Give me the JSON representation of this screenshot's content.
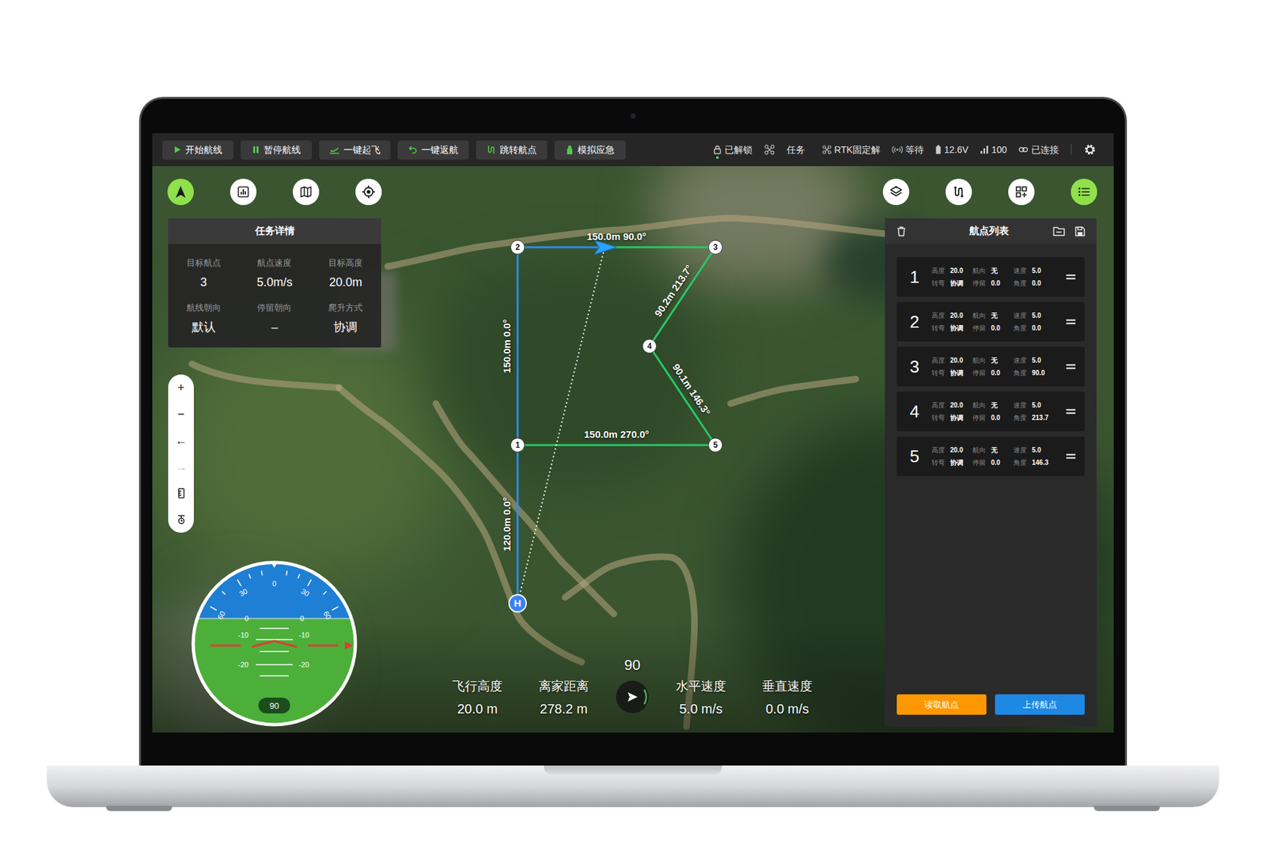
{
  "toolbar": {
    "actions": [
      "开始航线",
      "暂停航线",
      "一键起飞",
      "一键返航",
      "跳转航点",
      "模拟应急"
    ],
    "status": {
      "lock": {
        "label": "已解锁",
        "indicator": true
      },
      "mode": "任务",
      "rtk": "RTK固定解",
      "link_state": "等待",
      "voltage": "12.6V",
      "signal": "100",
      "connection": "已连接"
    }
  },
  "map_buttons": {
    "left": [
      {
        "selected": true
      },
      {
        "selected": false
      },
      {
        "selected": false
      },
      {
        "selected": false
      }
    ],
    "right": [
      {
        "selected": false
      },
      {
        "selected": false
      },
      {
        "selected": false
      },
      {
        "selected": true
      }
    ]
  },
  "mission": {
    "title": "任务详情",
    "fields": [
      {
        "label": "目标航点",
        "value": "3"
      },
      {
        "label": "航点速度",
        "value": "5.0m/s"
      },
      {
        "label": "目标高度",
        "value": "20.0m"
      },
      {
        "label": "航线朝向",
        "value": "默认"
      },
      {
        "label": "停留朝向",
        "value": "–"
      },
      {
        "label": "爬升方式",
        "value": "协调"
      }
    ]
  },
  "zoom_tools": [
    {
      "label": "+",
      "disabled": false
    },
    {
      "label": "−",
      "disabled": false
    },
    {
      "label": "←",
      "disabled": false
    },
    {
      "label": "→",
      "disabled": true
    }
  ],
  "route": {
    "points": [
      {
        "label": "H",
        "kind": "home"
      },
      {
        "label": "1",
        "kind": "waypoint"
      },
      {
        "label": "2",
        "kind": "waypoint"
      },
      {
        "label": "3",
        "kind": "waypoint"
      },
      {
        "label": "4",
        "kind": "waypoint"
      },
      {
        "label": "5",
        "kind": "waypoint"
      }
    ],
    "segments": [
      {
        "label": "120.0m 0.0°",
        "level": 1
      },
      {
        "label": "150.0m 0.0°",
        "level": 1
      },
      {
        "label": "150.0m 90.0°",
        "level": 0.44
      },
      {
        "label": "90.2m 213.7°",
        "level": 0
      },
      {
        "label": "90.1m 146.3°",
        "level": 0
      },
      {
        "label": "150.0m 270.0°",
        "level": 0
      }
    ]
  },
  "attitude": {
    "roll_scale": [
      "60",
      "30",
      "0",
      "30",
      "60"
    ],
    "pitch_scale": [
      "0",
      "0",
      "-10",
      "-10",
      "-20",
      "-20"
    ],
    "heading": "90"
  },
  "telemetry": {
    "heading": "90",
    "readouts": [
      {
        "label": "飞行高度",
        "value": "20.0 m"
      },
      {
        "label": "离家距离",
        "value": "278.2 m"
      },
      {
        "label": "水平速度",
        "value": "5.0 m/s"
      },
      {
        "label": "垂直速度",
        "value": "0.0 m/s"
      }
    ]
  },
  "waypoint_list": {
    "title": "航点列表",
    "rows": [
      {
        "number": "1",
        "fields": [
          {
            "label": "高度",
            "value": "20.0"
          },
          {
            "label": "航向",
            "value": "无"
          },
          {
            "label": "速度",
            "value": "5.0"
          },
          {
            "label": "转弯",
            "value": "协调"
          },
          {
            "label": "停留",
            "value": "0.0"
          },
          {
            "label": "角度",
            "value": "0.0"
          }
        ]
      },
      {
        "number": "2",
        "fields": [
          {
            "label": "高度",
            "value": "20.0"
          },
          {
            "label": "航向",
            "value": "无"
          },
          {
            "label": "速度",
            "value": "5.0"
          },
          {
            "label": "转弯",
            "value": "协调"
          },
          {
            "label": "停留",
            "value": "0.0"
          },
          {
            "label": "角度",
            "value": "0.0"
          }
        ]
      },
      {
        "number": "3",
        "fields": [
          {
            "label": "高度",
            "value": "20.0"
          },
          {
            "label": "航向",
            "value": "无"
          },
          {
            "label": "速度",
            "value": "5.0"
          },
          {
            "label": "转弯",
            "value": "协调"
          },
          {
            "label": "停留",
            "value": "0.0"
          },
          {
            "label": "角度",
            "value": "90.0"
          }
        ]
      },
      {
        "number": "4",
        "fields": [
          {
            "label": "高度",
            "value": "20.0"
          },
          {
            "label": "航向",
            "value": "无"
          },
          {
            "label": "速度",
            "value": "5.0"
          },
          {
            "label": "转弯",
            "value": "协调"
          },
          {
            "label": "停留",
            "value": "0.0"
          },
          {
            "label": "角度",
            "value": "213.7"
          }
        ]
      },
      {
        "number": "5",
        "fields": [
          {
            "label": "高度",
            "value": "20.0"
          },
          {
            "label": "航向",
            "value": "无"
          },
          {
            "label": "速度",
            "value": "5.0"
          },
          {
            "label": "转弯",
            "value": "协调"
          },
          {
            "label": "停留",
            "value": "0.0"
          },
          {
            "label": "角度",
            "value": "146.3"
          }
        ]
      }
    ],
    "buttons": [
      "读取航点",
      "上传航点"
    ]
  }
}
